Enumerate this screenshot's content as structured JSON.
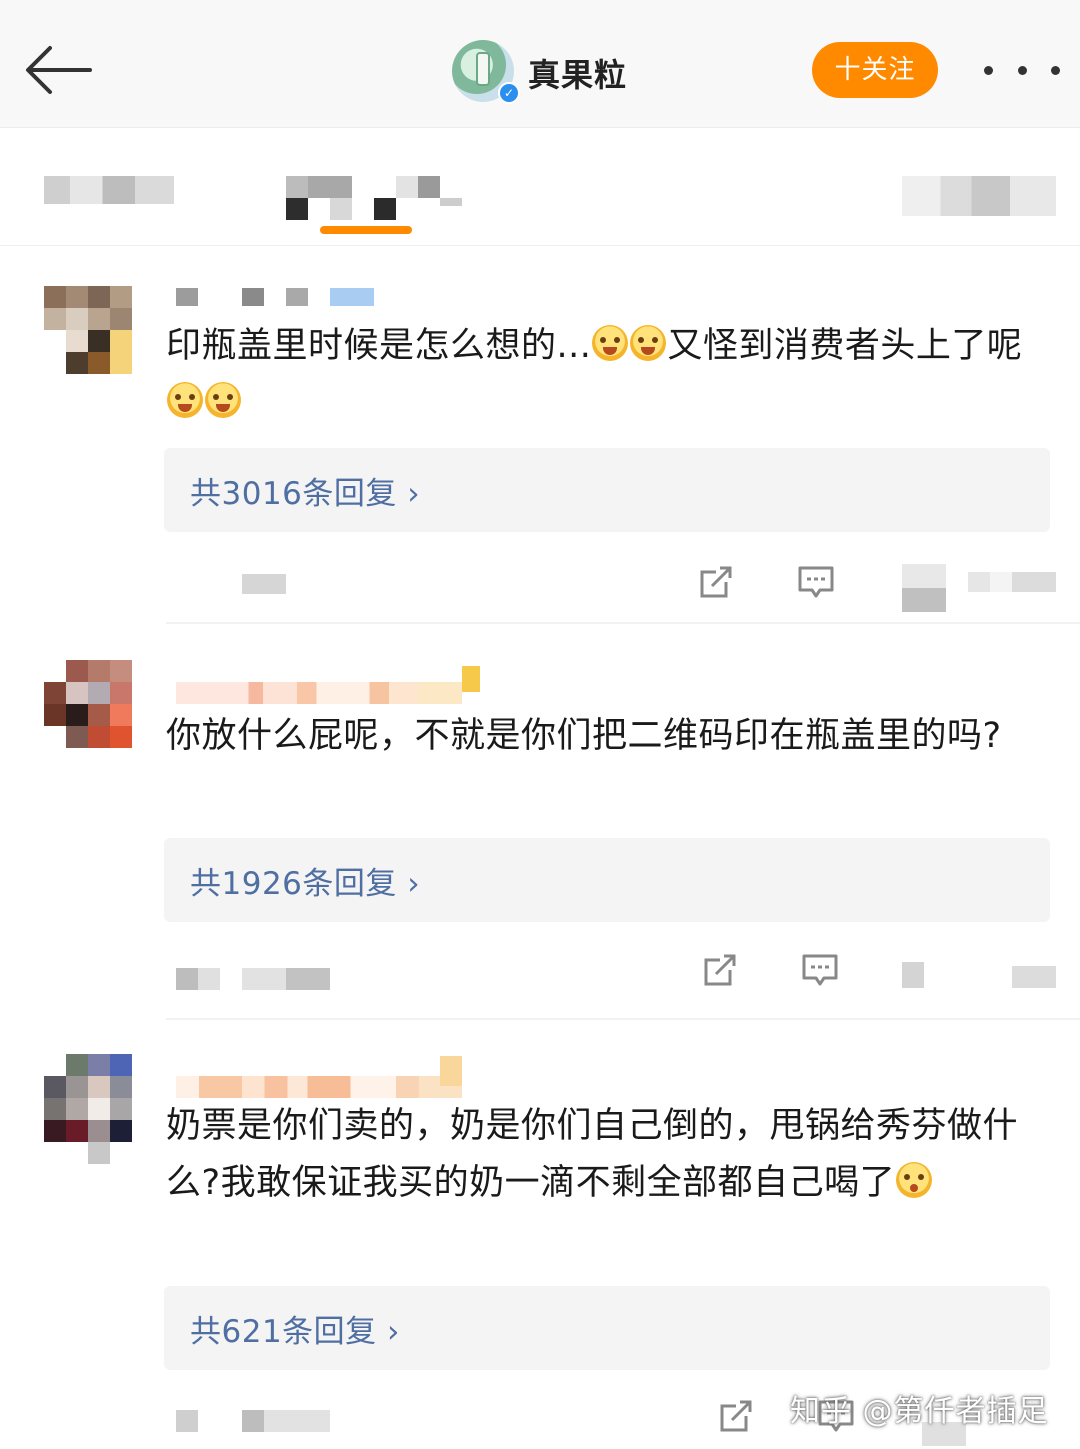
{
  "header": {
    "account_name": "真果粒",
    "follow_label": "十关注"
  },
  "comments": [
    {
      "text_a": "印瓶盖里时候是怎么想的...",
      "text_b": "又怪到消费者头上了呢",
      "reply_link": "共3016条回复 ›"
    },
    {
      "text": "你放什么屁呢，不就是你们把二维码印在瓶盖里的吗?",
      "reply_link": "共1926条回复 ›"
    },
    {
      "text": "奶票是你们卖的，奶是你们自己倒的，甩锅给秀芬做什么?我敢保证我买的奶一滴不剩全部都自己喝了",
      "reply_link": "共621条回复 ›"
    }
  ],
  "watermark": "知乎 @第仟者插足",
  "colors": {
    "accent": "#ff8a00",
    "link": "#4f6fa3",
    "verify": "#2b8ff0"
  },
  "icons": [
    "back-arrow-icon",
    "verified-badge-icon",
    "more-icon",
    "share-icon",
    "reply-icon",
    "emoji-icon"
  ]
}
